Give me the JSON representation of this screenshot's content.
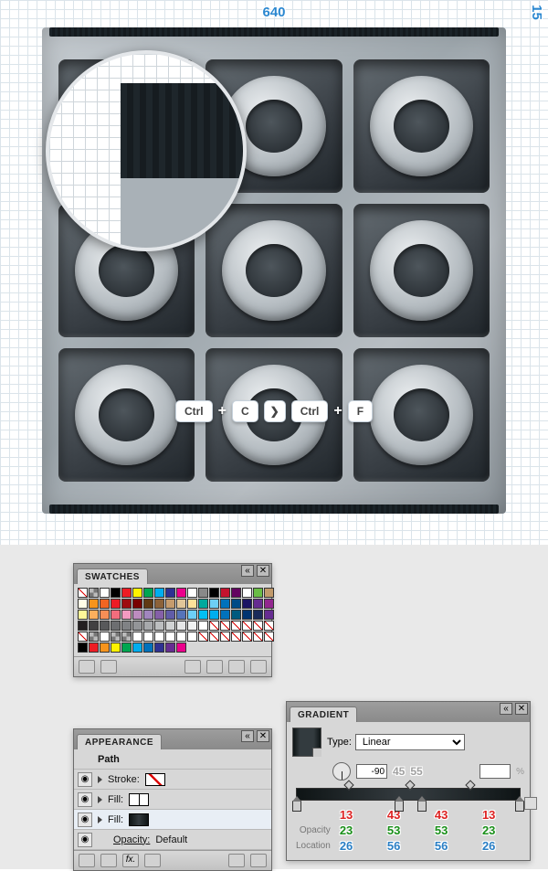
{
  "canvas": {
    "top_measure": "640",
    "side_measure": "15"
  },
  "shortcut": {
    "ctrl1": "Ctrl",
    "c": "C",
    "arrow": "❯",
    "ctrl2": "Ctrl",
    "f": "F"
  },
  "panels": {
    "swatches": {
      "title": "SWATCHES",
      "colors": [
        "none",
        "reg",
        "#ffffff",
        "#000000",
        "#ed1c24",
        "#fff200",
        "#00a651",
        "#00aeef",
        "#2e3192",
        "#ec008c",
        "#ffffff",
        "#898989",
        "#000000",
        "#c4122e",
        "#630460",
        "#ffffff",
        "#69bd45",
        "#c19a6b",
        "#fffde7",
        "#f7941d",
        "#f26522",
        "#ed1c24",
        "#9e0b0f",
        "#790000",
        "#603913",
        "#8c6239",
        "#c69c6d",
        "#e1c699",
        "#ffe29a",
        "#00a99d",
        "#6dcff6",
        "#0072bc",
        "#004b87",
        "#1b1464",
        "#662d91",
        "#92278f",
        "#fff799",
        "#fbaf5d",
        "#f68e56",
        "#f26d7d",
        "#f49ac1",
        "#bd8cbf",
        "#a186be",
        "#8560a8",
        "#605ca8",
        "#5674b9",
        "#6dcff6",
        "#00bff3",
        "#00aeef",
        "#0072bc",
        "#005b7f",
        "#003471",
        "#1a2b5a",
        "#662d91",
        "#231f20",
        "#414042",
        "#58595b",
        "#6d6e71",
        "#808285",
        "#939598",
        "#a7a9ac",
        "#bcbec0",
        "#d1d3d4",
        "#e6e7e8",
        "#f1f2f2",
        "#ffffff",
        "none",
        "none",
        "none",
        "none",
        "none",
        "none",
        "none",
        "reg",
        "#ffffff",
        "reg",
        "reg",
        "#ffffff",
        "#ffffff",
        "#ffffff",
        "#ffffff",
        "#ffffff",
        "#ffffff",
        "none",
        "none",
        "none",
        "none",
        "none",
        "none",
        "none",
        "#000000",
        "#ed1c24",
        "#f7941d",
        "#fff200",
        "#00a651",
        "#00aeef",
        "#0072bc",
        "#2e3192",
        "#662d91",
        "#ec008c"
      ]
    },
    "appearance": {
      "title": "APPEARANCE",
      "path_label": "Path",
      "stroke_label": "Stroke:",
      "fill_label": "Fill:",
      "fill2_label": "Fill:",
      "opacity_label": "Opacity:",
      "opacity_value": "Default"
    },
    "gradient": {
      "title": "GRADIENT",
      "type_label": "Type:",
      "type_value": "Linear",
      "angle_value": "-90",
      "angle_aux1": "45",
      "angle_aux2": "55",
      "opacity_label": "Opacity",
      "location_label": "Location",
      "stops": [
        {
          "r": "13",
          "g": "23",
          "b": "26",
          "pos": 0
        },
        {
          "r": "43",
          "g": "53",
          "b": "56",
          "pos": 45
        },
        {
          "r": "43",
          "g": "53",
          "b": "56",
          "pos": 55
        },
        {
          "r": "13",
          "g": "23",
          "b": "26",
          "pos": 100
        }
      ]
    }
  }
}
